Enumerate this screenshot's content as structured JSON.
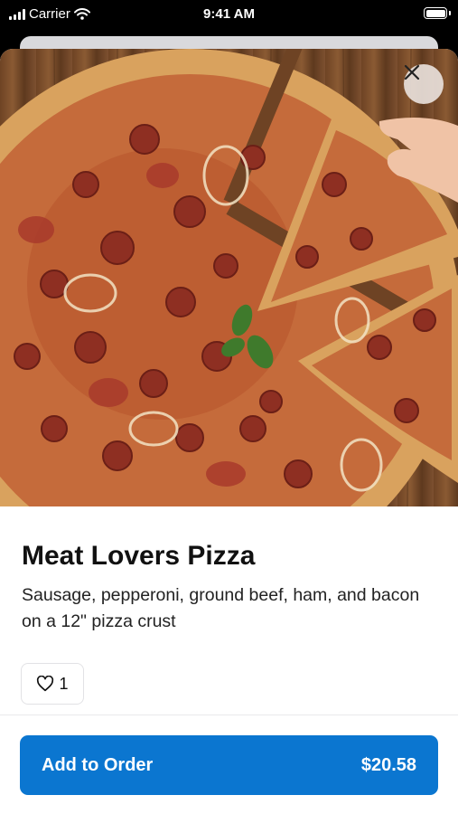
{
  "status_bar": {
    "carrier": "Carrier",
    "time": "9:41 AM",
    "signal_icon": "signal-icon",
    "wifi_icon": "wifi-icon",
    "battery_icon": "battery-icon"
  },
  "product": {
    "image": {
      "subject": "pizza-photo"
    },
    "close_icon": "close-icon",
    "name": "Meat Lovers Pizza",
    "description": "Sausage, pepperoni, ground beef, ham, and bacon on a 12\" pizza crust",
    "likes": {
      "icon": "heart-icon",
      "count": "1"
    }
  },
  "order": {
    "label": "Add to Order",
    "price": "$20.58"
  },
  "colors": {
    "accent": "#0b76d0",
    "background": "#ffffff",
    "status_bar": "#000000"
  }
}
